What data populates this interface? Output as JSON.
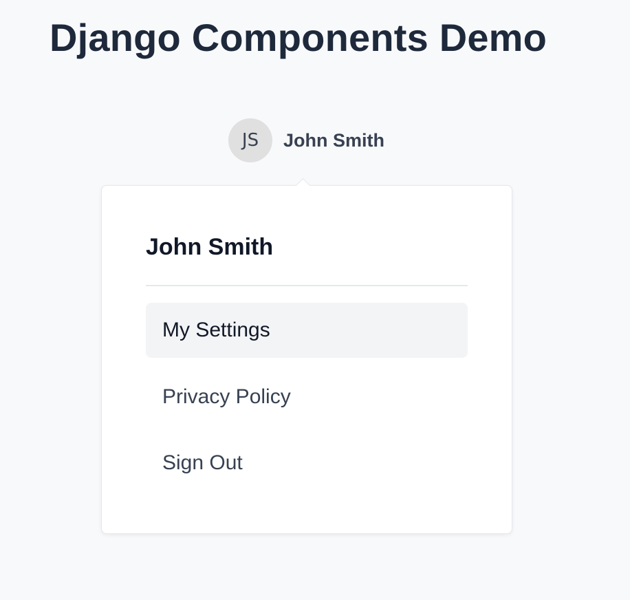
{
  "page": {
    "title": "Django Components Demo"
  },
  "user": {
    "initials": "JS",
    "name": "John Smith"
  },
  "dropdown": {
    "header": "John Smith",
    "items": [
      {
        "label": "My Settings",
        "active": true
      },
      {
        "label": "Privacy Policy",
        "active": false
      },
      {
        "label": "Sign Out",
        "active": false
      }
    ]
  },
  "colors": {
    "background": "#f8f9fb",
    "title": "#1e293b",
    "avatar_bg": "#e0e0e0",
    "menu_active_bg": "#f3f4f6",
    "border": "#e5e7eb"
  }
}
